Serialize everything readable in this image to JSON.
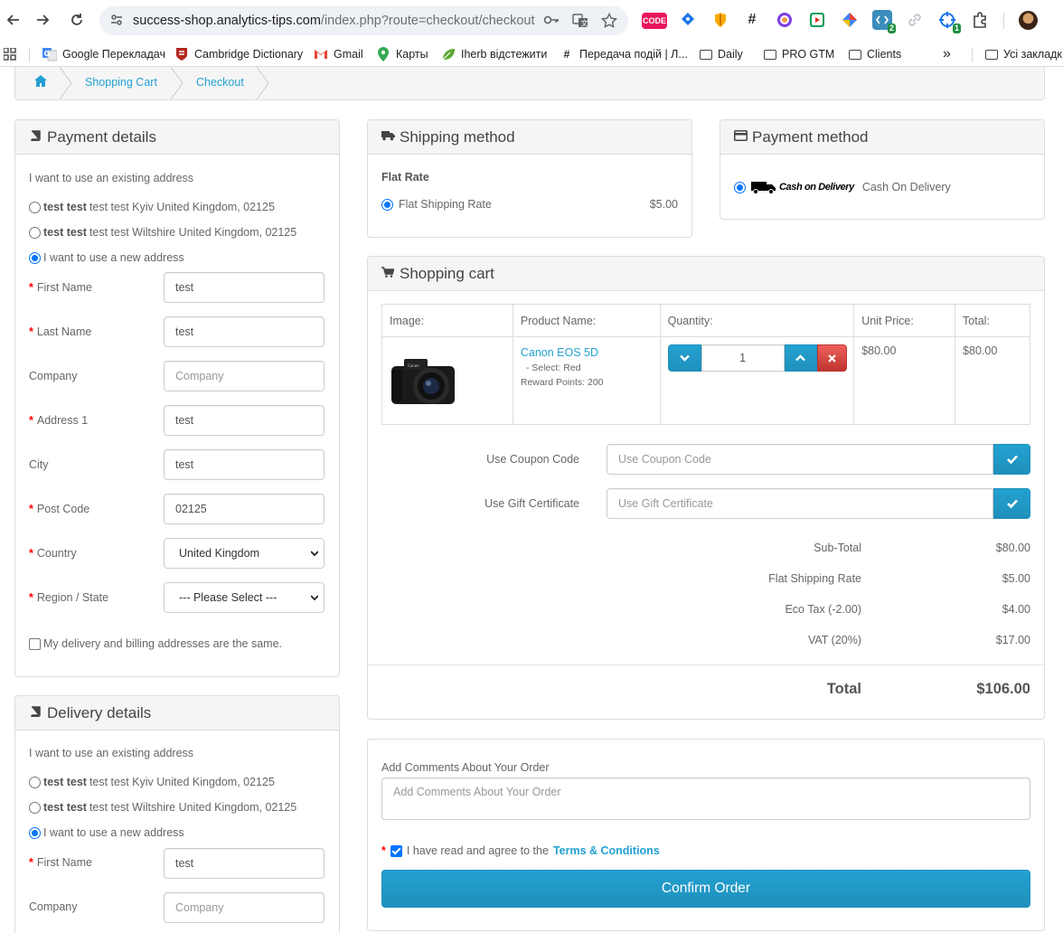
{
  "browser": {
    "url_host": "success-shop.analytics-tips.com",
    "url_path": "/index.php?route=checkout/checkout",
    "extensions": [
      {
        "name": "code-extension",
        "label": "CODE",
        "color": "#e9165a"
      },
      {
        "name": "tag-assistant-extension",
        "label": "",
        "color": "#1a73e8"
      },
      {
        "name": "shield-extension",
        "label": "",
        "color": "#f9ab00"
      },
      {
        "name": "hashtag-extension",
        "label": "#",
        "color": "#24292f"
      },
      {
        "name": "color-picker-extension",
        "label": "",
        "color": "#7b3fe4"
      },
      {
        "name": "youtube-extension",
        "label": "",
        "color": "#d93025"
      },
      {
        "name": "diamond-extension",
        "label": "",
        "color": "#4285f4"
      },
      {
        "name": "dev-extension",
        "label": "",
        "color": "#3c8dbc",
        "badge": "2"
      },
      {
        "name": "link-extension",
        "label": "",
        "color": "#bdc1c6"
      },
      {
        "name": "crosshair-extension",
        "label": "",
        "color": "#1a73e8",
        "badge": "1"
      }
    ],
    "bookmarks": [
      {
        "label": "Google Перекладач",
        "icon": "google-translate-icon"
      },
      {
        "label": "Cambridge Dictionary",
        "icon": "cambridge-icon"
      },
      {
        "label": "Gmail",
        "icon": "gmail-icon"
      },
      {
        "label": "Карты",
        "icon": "maps-icon"
      },
      {
        "label": "Iherb відстежити",
        "icon": "leaf-icon"
      },
      {
        "label": "Передача подій | Л...",
        "icon": "hashtag-icon"
      },
      {
        "label": "Daily",
        "icon": "folder-icon"
      },
      {
        "label": "PRO GTM",
        "icon": "folder-icon"
      },
      {
        "label": "Clients",
        "icon": "folder-icon"
      }
    ],
    "more_bookmarks": "»",
    "all_bookmarks": "Усі закладк"
  },
  "breadcrumb": {
    "home_icon": "home-icon",
    "items": [
      "Shopping Cart",
      "Checkout"
    ]
  },
  "payment_details": {
    "title": "Payment details",
    "existing_label": "I want to use an existing address",
    "addresses": [
      {
        "name": "test test",
        "rest": "test test Kyiv United Kingdom, 02125"
      },
      {
        "name": "test test",
        "rest": "test test Wiltshire United Kingdom, 02125"
      }
    ],
    "new_address_label": "I want to use a new address",
    "fields": {
      "first_name": {
        "label": "First Name",
        "value": "test"
      },
      "last_name": {
        "label": "Last Name",
        "value": "test"
      },
      "company": {
        "label": "Company",
        "placeholder": "Company"
      },
      "address1": {
        "label": "Address 1",
        "value": "test"
      },
      "city": {
        "label": "City",
        "value": "test"
      },
      "postcode": {
        "label": "Post Code",
        "value": "02125"
      },
      "country": {
        "label": "Country",
        "value": "United Kingdom"
      },
      "region": {
        "label": "Region / State",
        "value": "--- Please Select ---"
      }
    },
    "same_address_label": "My delivery and billing addresses are the same."
  },
  "delivery_details": {
    "title": "Delivery details",
    "existing_label": "I want to use an existing address",
    "addresses": [
      {
        "name": "test test",
        "rest": "test test Kyiv United Kingdom, 02125"
      },
      {
        "name": "test test",
        "rest": "test test Wiltshire United Kingdom, 02125"
      }
    ],
    "new_address_label": "I want to use a new address",
    "fields": {
      "first_name": {
        "label": "First Name",
        "value": "test"
      },
      "company": {
        "label": "Company",
        "placeholder": "Company"
      }
    }
  },
  "shipping_method": {
    "title": "Shipping method",
    "group": "Flat Rate",
    "option_label": "Flat Shipping Rate",
    "option_price": "$5.00"
  },
  "payment_method": {
    "title": "Payment method",
    "logo_text": "Cash on Delivery",
    "option_label": "Cash On Delivery"
  },
  "cart": {
    "title": "Shopping cart",
    "headers": {
      "image": "Image:",
      "product": "Product Name:",
      "quantity": "Quantity:",
      "unit_price": "Unit Price:",
      "total": "Total:"
    },
    "item": {
      "name": "Canon EOS 5D",
      "option": "- Select: Red",
      "reward": "Reward Points: 200",
      "quantity": "1",
      "unit_price": "$80.00",
      "total": "$80.00"
    },
    "coupon_label": "Use Coupon Code",
    "coupon_placeholder": "Use Coupon Code",
    "gift_label": "Use Gift Certificate",
    "gift_placeholder": "Use Gift Certificate",
    "totals": [
      {
        "label": "Sub-Total",
        "value": "$80.00"
      },
      {
        "label": "Flat Shipping Rate",
        "value": "$5.00"
      },
      {
        "label": "Eco Tax (-2.00)",
        "value": "$4.00"
      },
      {
        "label": "VAT (20%)",
        "value": "$17.00"
      }
    ],
    "grand_total_label": "Total",
    "grand_total_value": "$106.00"
  },
  "comments": {
    "label": "Add Comments About Your Order",
    "placeholder": "Add Comments About Your Order",
    "agree_prefix": "I have read and agree to the",
    "agree_link": "Terms & Conditions",
    "confirm_label": "Confirm Order"
  }
}
